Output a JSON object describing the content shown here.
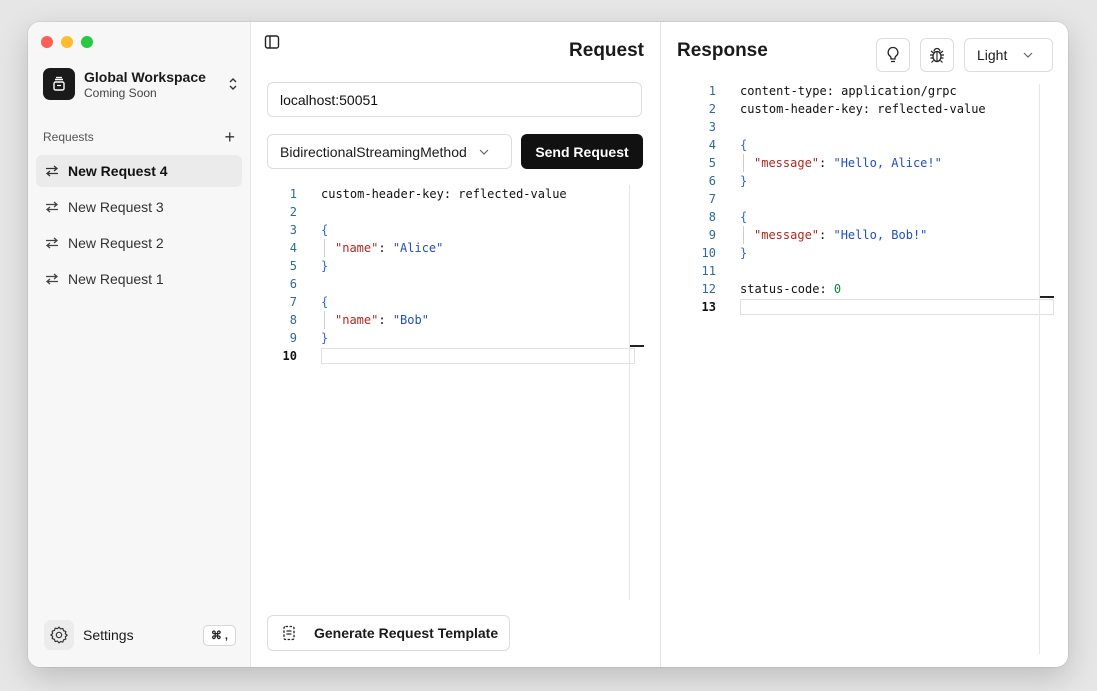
{
  "sidebar": {
    "workspace": {
      "title": "Global Workspace",
      "subtitle": "Coming Soon"
    },
    "requests_header": "Requests",
    "items": [
      {
        "label": "New Request 4",
        "active": true
      },
      {
        "label": "New Request 3",
        "active": false
      },
      {
        "label": "New Request 2",
        "active": false
      },
      {
        "label": "New Request 1",
        "active": false
      }
    ],
    "settings_label": "Settings",
    "settings_shortcut": "⌘ ,"
  },
  "request": {
    "title": "Request",
    "url": "localhost:50051",
    "method": "BidirectionalStreamingMethod",
    "send_label": "Send Request",
    "generate_label": "Generate Request Template",
    "editor_lines": [
      "custom-header-key: reflected-value",
      "",
      "{",
      "  \"name\": \"Alice\"",
      "}",
      "",
      "{",
      "  \"name\": \"Bob\"",
      "}",
      ""
    ]
  },
  "response": {
    "title": "Response",
    "theme": "Light",
    "editor_lines": [
      "content-type: application/grpc",
      "custom-header-key: reflected-value",
      "",
      "{",
      "  \"message\": \"Hello, Alice!\"",
      "}",
      "",
      "{",
      "  \"message\": \"Hello, Bob!\"",
      "}",
      "",
      "status-code: 0",
      ""
    ]
  },
  "colors": {
    "traffic_red": "#fe5f57",
    "traffic_yellow": "#febc2e",
    "traffic_green": "#28c840",
    "accent": "#111111"
  },
  "icons": {
    "workspace": "stack-icon",
    "chevrons": "chevron-up-down-icon",
    "add": "plus-icon",
    "request": "arrows-left-right-icon",
    "settings": "gear-icon",
    "toggle": "sidebar-toggle-icon",
    "generate": "template-icon",
    "hint": "lightbulb-icon",
    "debug": "bug-icon"
  }
}
